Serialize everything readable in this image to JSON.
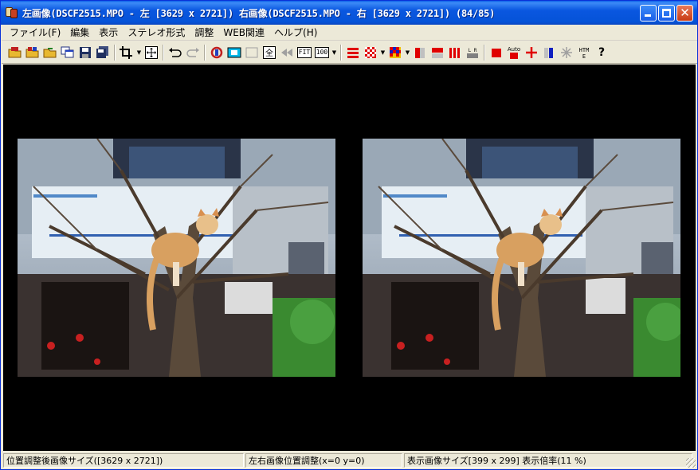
{
  "window": {
    "title": "左画像(DSCF2515.MPO - 左 [3629 x 2721]) 右画像(DSCF2515.MPO - 右 [3629 x 2721]) (84/85)"
  },
  "menu": [
    "ファイル(F)",
    "編集",
    "表示",
    "ステレオ形式",
    "調整",
    "WEB関連",
    "ヘルプ(H)"
  ],
  "toolbar": {
    "fit_label": "FIT",
    "zoom100_label": "100",
    "auto_label": "Auto",
    "htm_label": "HTM",
    "help_label": "?",
    "colors": {
      "red": "#e00000",
      "blue": "#1020c0",
      "cyan": "#00b8e8",
      "yellow": "#f0c000",
      "green": "#20a020"
    }
  },
  "status": {
    "pane1": "位置調整後画像サイズ([3629 x 2721])",
    "pane2": "左右画像位置調整(x=0 y=0)",
    "pane3": "表示画像サイズ[399 x 299]  表示倍率(11 %)"
  }
}
